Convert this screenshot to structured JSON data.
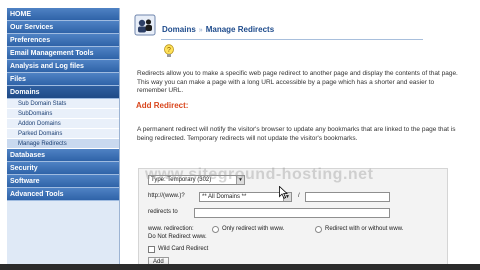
{
  "sidebar": {
    "items": [
      {
        "label": "HOME"
      },
      {
        "label": "Our Services"
      },
      {
        "label": "Preferences"
      },
      {
        "label": "Email Management Tools"
      },
      {
        "label": "Analysis and Log files"
      },
      {
        "label": "Files"
      },
      {
        "label": "Domains"
      }
    ],
    "sub_items": [
      {
        "label": "Sub Domain Stats"
      },
      {
        "label": "SubDomains"
      },
      {
        "label": "Addon Domains"
      },
      {
        "label": "Parked Domains"
      },
      {
        "label": "Manage Redirects"
      }
    ],
    "items_after": [
      {
        "label": "Databases"
      },
      {
        "label": "Security"
      },
      {
        "label": "Software"
      },
      {
        "label": "Advanced Tools"
      }
    ]
  },
  "header": {
    "section": "Domains",
    "separator": "»",
    "page": "Manage Redirects",
    "icon": "domains-icon"
  },
  "intro_text": "Redirects allow you to make a specific web page redirect to another page and display the contents of that page. This way you can make a page with a long URL accessible by a page which has a shorter and easier to remember URL.",
  "add_redirect": {
    "title": "Add Redirect:",
    "description": "A permanent redirect will notify the visitor's browser to update any bookmarks that are linked to the page that is being redirected. Temporary redirects will not update the visitor's bookmarks."
  },
  "form": {
    "type_label": "Type",
    "type_value": "Temporary (302)",
    "protocol_label": "http://(www.)?",
    "domain_value": "** All Domains **",
    "path_separator": "/",
    "redirects_to_label": "redirects to",
    "www_label": "www. redirection:",
    "www_options": [
      {
        "label": "Only redirect with www."
      },
      {
        "label": "Redirect with or without www."
      },
      {
        "label": "Do Not Redirect www."
      }
    ],
    "wildcard_label": "Wild Card Redirect",
    "add_button": "Add"
  },
  "watermark": "www.siteground-hosting.net"
}
